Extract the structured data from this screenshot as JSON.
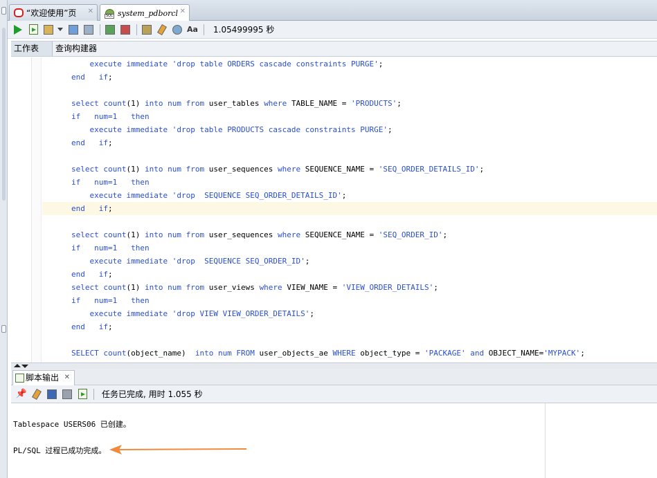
{
  "tabs": [
    {
      "label": "“欢迎使用”页",
      "active": false
    },
    {
      "label": "system_pdborcl",
      "active": true
    }
  ],
  "toolbar": {
    "timing": "1.05499995 秒"
  },
  "subtabs": [
    "工作表",
    "查询构建器"
  ],
  "editor": {
    "lines": [
      [
        {
          "t": "    ",
          "c": "plain"
        },
        {
          "t": "execute immediate ",
          "c": "kw"
        },
        {
          "t": "'drop table ORDERS cascade constraints PURGE'",
          "c": "str"
        },
        {
          "t": ";",
          "c": "plain"
        }
      ],
      [
        {
          "t": "end   if",
          "c": "kw"
        },
        {
          "t": ";",
          "c": "plain"
        }
      ],
      [],
      [
        {
          "t": "select count",
          "c": "kw"
        },
        {
          "t": "(1) ",
          "c": "plain"
        },
        {
          "t": "into num from ",
          "c": "kw"
        },
        {
          "t": "user_tables ",
          "c": "plain"
        },
        {
          "t": "where ",
          "c": "kw"
        },
        {
          "t": "TABLE_NAME = ",
          "c": "plain"
        },
        {
          "t": "'PRODUCTS'",
          "c": "str"
        },
        {
          "t": ";",
          "c": "plain"
        }
      ],
      [
        {
          "t": "if   ",
          "c": "kw"
        },
        {
          "t": "num=1   ",
          "c": "kw"
        },
        {
          "t": "then",
          "c": "kw"
        }
      ],
      [
        {
          "t": "    ",
          "c": "plain"
        },
        {
          "t": "execute immediate ",
          "c": "kw"
        },
        {
          "t": "'drop table PRODUCTS cascade constraints PURGE'",
          "c": "str"
        },
        {
          "t": ";",
          "c": "plain"
        }
      ],
      [
        {
          "t": "end   if",
          "c": "kw"
        },
        {
          "t": ";",
          "c": "plain"
        }
      ],
      [],
      [
        {
          "t": "select count",
          "c": "kw"
        },
        {
          "t": "(1) ",
          "c": "plain"
        },
        {
          "t": "into num from ",
          "c": "kw"
        },
        {
          "t": "user_sequences ",
          "c": "plain"
        },
        {
          "t": "where ",
          "c": "kw"
        },
        {
          "t": "SEQUENCE_NAME = ",
          "c": "plain"
        },
        {
          "t": "'SEQ_ORDER_DETAILS_ID'",
          "c": "str"
        },
        {
          "t": ";",
          "c": "plain"
        }
      ],
      [
        {
          "t": "if   ",
          "c": "kw"
        },
        {
          "t": "num=1   ",
          "c": "kw"
        },
        {
          "t": "then",
          "c": "kw"
        }
      ],
      [
        {
          "t": "    ",
          "c": "plain"
        },
        {
          "t": "execute immediate ",
          "c": "kw"
        },
        {
          "t": "'drop  SEQUENCE SEQ_ORDER_DETAILS_ID'",
          "c": "str"
        },
        {
          "t": ";",
          "c": "plain"
        }
      ],
      [
        {
          "t": "end   if",
          "c": "kw"
        },
        {
          "t": ";",
          "c": "plain"
        }
      ],
      [],
      [
        {
          "t": "select count",
          "c": "kw"
        },
        {
          "t": "(1) ",
          "c": "plain"
        },
        {
          "t": "into num from ",
          "c": "kw"
        },
        {
          "t": "user_sequences ",
          "c": "plain"
        },
        {
          "t": "where ",
          "c": "kw"
        },
        {
          "t": "SEQUENCE_NAME = ",
          "c": "plain"
        },
        {
          "t": "'SEQ_ORDER_ID'",
          "c": "str"
        },
        {
          "t": ";",
          "c": "plain"
        }
      ],
      [
        {
          "t": "if   ",
          "c": "kw"
        },
        {
          "t": "num=1   ",
          "c": "kw"
        },
        {
          "t": "then",
          "c": "kw"
        }
      ],
      [
        {
          "t": "    ",
          "c": "plain"
        },
        {
          "t": "execute immediate ",
          "c": "kw"
        },
        {
          "t": "'drop  SEQUENCE SEQ_ORDER_ID'",
          "c": "str"
        },
        {
          "t": ";",
          "c": "plain"
        }
      ],
      [
        {
          "t": "end   if",
          "c": "kw"
        },
        {
          "t": ";",
          "c": "plain"
        }
      ],
      [
        {
          "t": "select count",
          "c": "kw"
        },
        {
          "t": "(1) ",
          "c": "plain"
        },
        {
          "t": "into num from ",
          "c": "kw"
        },
        {
          "t": "user_views ",
          "c": "plain"
        },
        {
          "t": "where ",
          "c": "kw"
        },
        {
          "t": "VIEW_NAME = ",
          "c": "plain"
        },
        {
          "t": "'VIEW_ORDER_DETAILS'",
          "c": "str"
        },
        {
          "t": ";",
          "c": "plain"
        }
      ],
      [
        {
          "t": "if   ",
          "c": "kw"
        },
        {
          "t": "num=1   ",
          "c": "kw"
        },
        {
          "t": "then",
          "c": "kw"
        }
      ],
      [
        {
          "t": "    ",
          "c": "plain"
        },
        {
          "t": "execute immediate ",
          "c": "kw"
        },
        {
          "t": "'drop VIEW VIEW_ORDER_DETAILS'",
          "c": "str"
        },
        {
          "t": ";",
          "c": "plain"
        }
      ],
      [
        {
          "t": "end   if",
          "c": "kw"
        },
        {
          "t": ";",
          "c": "plain"
        }
      ],
      [],
      [
        {
          "t": "SELECT count",
          "c": "kw"
        },
        {
          "t": "(object_name)  ",
          "c": "plain"
        },
        {
          "t": "into num FROM ",
          "c": "kw"
        },
        {
          "t": "user_objects_ae ",
          "c": "plain"
        },
        {
          "t": "WHERE ",
          "c": "kw"
        },
        {
          "t": "object_type = ",
          "c": "plain"
        },
        {
          "t": "'PACKAGE' ",
          "c": "str"
        },
        {
          "t": "and ",
          "c": "kw"
        },
        {
          "t": "OBJECT_NAME=",
          "c": "plain"
        },
        {
          "t": "'MYPACK'",
          "c": "str"
        },
        {
          "t": ";",
          "c": "plain"
        }
      ]
    ]
  },
  "output": {
    "tab_label": "脚本输出",
    "status": "任务已完成, 用时 1.055 秒",
    "lines": [
      "Tablespace USERS06 已创建。",
      "PL/SQL 过程已成功完成。"
    ]
  },
  "colors": {
    "keyword": "#2a4fd0",
    "arrow": "#f08a3c",
    "highlight": "#fdf8e4"
  }
}
